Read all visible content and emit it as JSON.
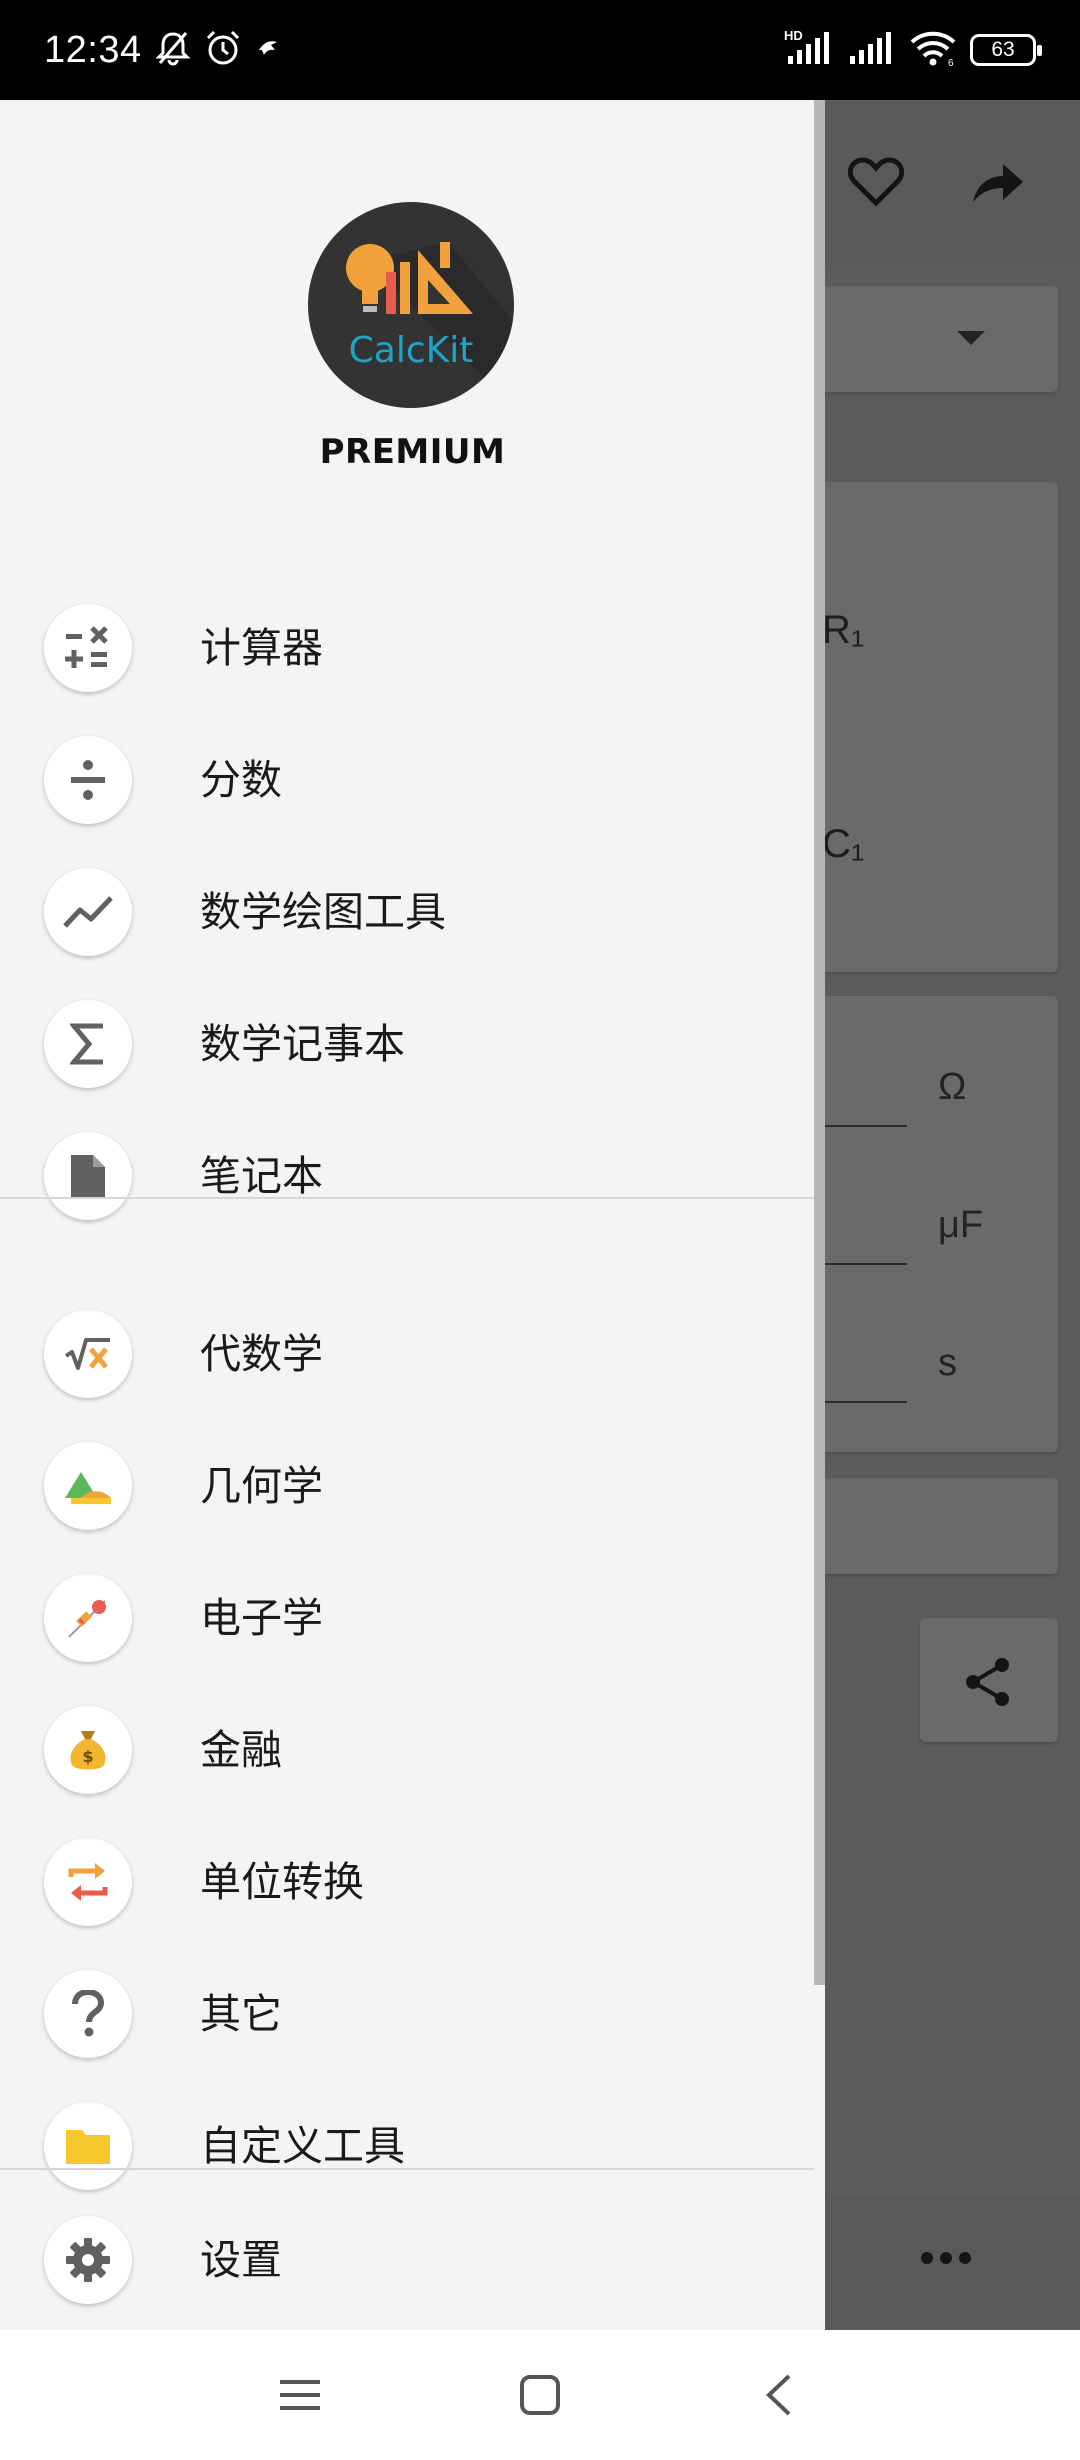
{
  "status_bar": {
    "time": "12:34",
    "battery": "63",
    "hd_label": "HD"
  },
  "background_app": {
    "labels": [
      "R₁",
      "C₁"
    ],
    "units": [
      "Ω",
      "μF",
      "s"
    ]
  },
  "drawer": {
    "logo_text": "CalcKit",
    "badge": "PREMIUM",
    "group_main": [
      {
        "label": "计算器",
        "icon": "calculator-icon"
      },
      {
        "label": "分数",
        "icon": "divide-icon"
      },
      {
        "label": "数学绘图工具",
        "icon": "trend-line-icon"
      },
      {
        "label": "数学记事本",
        "icon": "sigma-icon"
      },
      {
        "label": "笔记本",
        "icon": "document-icon"
      }
    ],
    "group_categories": [
      {
        "label": "代数学",
        "icon": "sqrt-x-icon"
      },
      {
        "label": "几何学",
        "icon": "triangle-ruler-icon"
      },
      {
        "label": "电子学",
        "icon": "resistor-led-icon"
      },
      {
        "label": "金融",
        "icon": "money-bag-icon"
      },
      {
        "label": "单位转换",
        "icon": "convert-arrows-icon"
      },
      {
        "label": "其它",
        "icon": "question-icon"
      },
      {
        "label": "自定义工具",
        "icon": "folder-icon"
      }
    ],
    "settings": {
      "label": "设置",
      "icon": "gear-icon"
    }
  },
  "colors": {
    "accent_orange": "#f2a23a",
    "logo_blue": "#1fa4c9",
    "folder_yellow": "#f7c82e",
    "icon_gray": "#616161"
  }
}
